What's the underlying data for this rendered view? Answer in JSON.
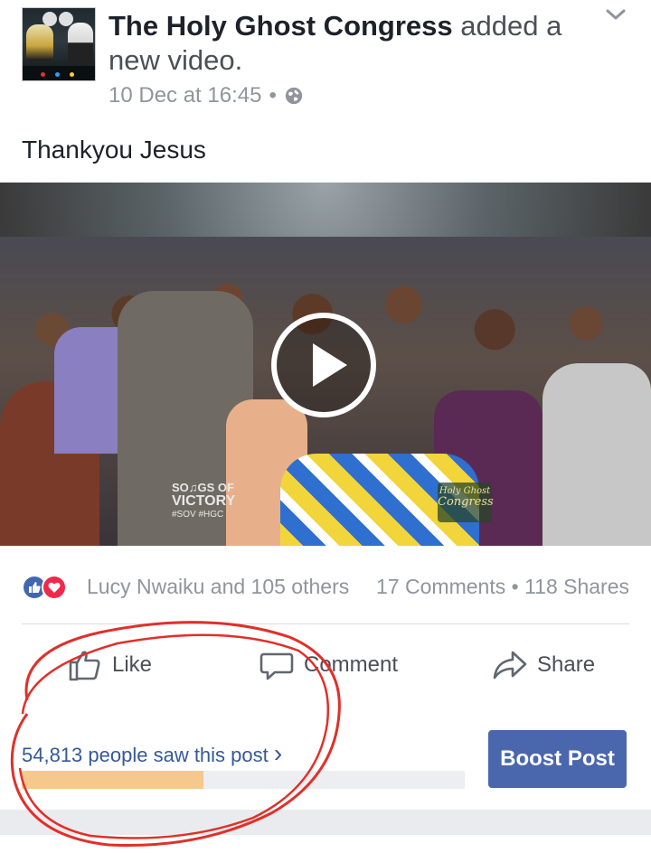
{
  "post": {
    "page_name": "The Holy Ghost Congress",
    "action_text": " added a new video.",
    "timestamp": "10 Dec at 16:45",
    "dot": "•",
    "privacy_icon": "globe-icon",
    "message": "Thankyou Jesus"
  },
  "video": {
    "watermark_left_line1": "SO♫GS OF",
    "watermark_left_line2": "VICTORY",
    "watermark_left_line3": "#SOV  #HGC",
    "watermark_right_line1": "Holy Ghost",
    "watermark_right_line2": "Congress"
  },
  "engagement": {
    "reacted_by": "Lucy Nwaiku and 105 others",
    "comments": "17 Comments",
    "separator": "•",
    "shares": "118 Shares"
  },
  "actions": {
    "like_label": "Like",
    "comment_label": "Comment",
    "share_label": "Share"
  },
  "insights": {
    "reach_text": "54,813 people saw this post",
    "chevron": "›",
    "reach_progress_fraction": 0.41,
    "boost_label": "Boost Post"
  },
  "colors": {
    "brand_blue": "#4267b2",
    "boost_blue": "#4a67ad",
    "link_blue": "#365899",
    "love_red": "#f0284a",
    "progress_orange": "#f7c88c",
    "annotation_red": "#e0302a"
  }
}
